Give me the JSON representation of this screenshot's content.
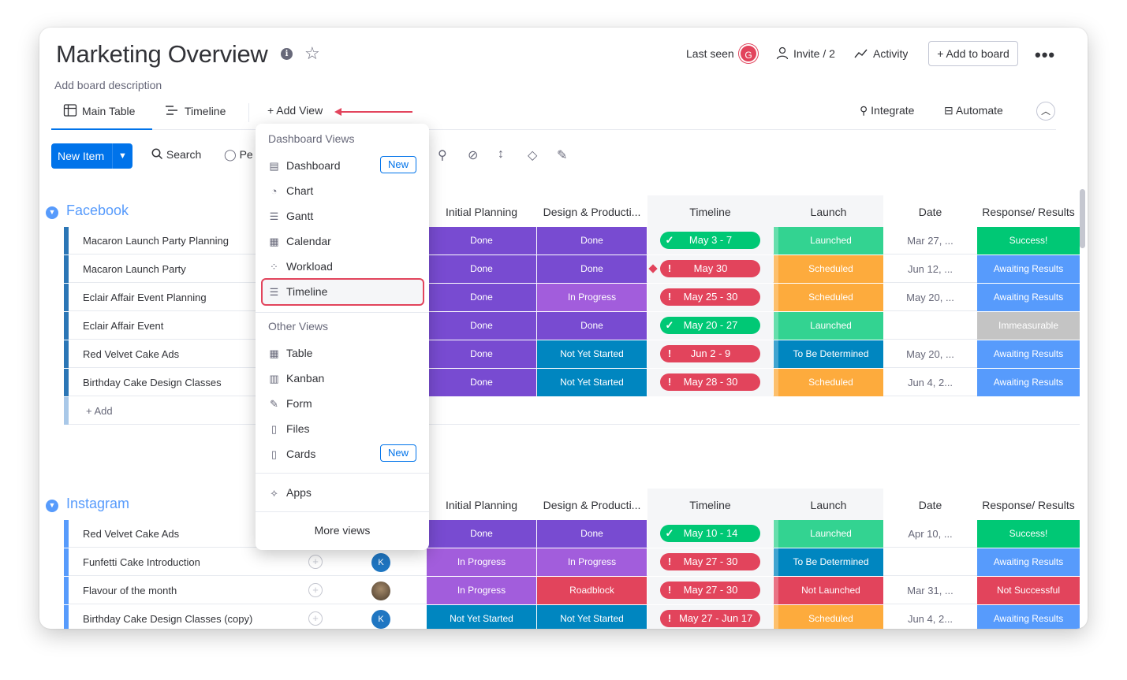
{
  "board": {
    "title": "Marketing Overview",
    "description": "Add board description"
  },
  "header": {
    "last_seen": "Last seen",
    "avatar_letter": "G",
    "invite": "Invite / 2",
    "activity": "Activity",
    "add_to_board": "+ Add to board",
    "more": "•••"
  },
  "tabs": {
    "main_table": "Main Table",
    "timeline": "Timeline",
    "add_view": "+ Add View",
    "integrate": "Integrate",
    "automate": "Automate"
  },
  "toolbar": {
    "new_item": "New Item",
    "search": "Search",
    "person": "Pe"
  },
  "columns": {
    "initial_planning": "Initial Planning",
    "design": "Design & Producti...",
    "timeline": "Timeline",
    "launch": "Launch",
    "date": "Date",
    "response": "Response/ Results"
  },
  "groups": [
    {
      "name": "Facebook",
      "color": "#579bfc",
      "rows": [
        {
          "name": "Macaron Launch Party Planning",
          "planning": "Done",
          "design": "Done",
          "timeline": "May 3 - 7",
          "tl_status": "done",
          "launch": "Launched",
          "date": "Mar 27, ...",
          "result": "Success!"
        },
        {
          "name": "Macaron Launch Party",
          "planning": "Done",
          "design": "Done",
          "timeline": "May 30",
          "tl_status": "alert",
          "launch": "Scheduled",
          "date": "Jun 12, ...",
          "result": "Awaiting Results"
        },
        {
          "name": "Eclair Affair Event Planning",
          "planning": "Done",
          "design": "In Progress",
          "timeline": "May 25 - 30",
          "tl_status": "alert",
          "launch": "Scheduled",
          "date": "May 20, ...",
          "result": "Awaiting Results"
        },
        {
          "name": "Eclair Affair Event",
          "planning": "Done",
          "design": "Done",
          "timeline": "May 20 - 27",
          "tl_status": "done",
          "launch": "Launched",
          "date": "",
          "result": "Immeasurable"
        },
        {
          "name": "Red Velvet Cake Ads",
          "planning": "Done",
          "design": "Not Yet Started",
          "timeline": "Jun 2 - 9",
          "tl_status": "alert",
          "launch": "To Be Determined",
          "date": "May 20, ...",
          "result": "Awaiting Results"
        },
        {
          "name": "Birthday Cake Design Classes",
          "planning": "Done",
          "design": "Not Yet Started",
          "timeline": "May 28 - 30",
          "tl_status": "alert",
          "launch": "Scheduled",
          "date": "Jun 4, 2...",
          "result": "Awaiting Results"
        }
      ],
      "add": "+ Add"
    },
    {
      "name": "Instagram",
      "color": "#579bfc",
      "rows": [
        {
          "name": "Red Velvet Cake Ads",
          "planning": "Done",
          "design": "Done",
          "timeline": "May 10 - 14",
          "tl_status": "done",
          "launch": "Launched",
          "date": "Apr 10, ...",
          "result": "Success!"
        },
        {
          "name": "Funfetti Cake Introduction",
          "planning": "In Progress",
          "design": "In Progress",
          "timeline": "May 27 - 30",
          "tl_status": "alert",
          "launch": "To Be Determined",
          "date": "",
          "result": "Awaiting Results",
          "avatar": "K"
        },
        {
          "name": "Flavour of the month",
          "planning": "In Progress",
          "design": "Roadblock",
          "timeline": "May 27 - 30",
          "tl_status": "alert",
          "launch": "Not Launched",
          "date": "Mar 31, ...",
          "result": "Not Successful",
          "avatar": "photo"
        },
        {
          "name": "Birthday Cake Design Classes (copy)",
          "planning": "Not Yet Started",
          "design": "Not Yet Started",
          "timeline": "May 27 - Jun 17",
          "tl_status": "alert",
          "launch": "Scheduled",
          "date": "Jun 4, 2...",
          "result": "Awaiting Results",
          "avatar": "K"
        }
      ]
    }
  ],
  "status_colors": {
    "Done": "#784bd1",
    "In Progress": "#a25ddc",
    "Not Yet Started": "#0086c0",
    "Roadblock": "#e2445c",
    "Launched": "#33d391",
    "Scheduled": "#fdab3d",
    "To Be Determined": "#0086c0",
    "Not Launched": "#e2445c",
    "Success!": "#00c875",
    "Awaiting Results": "#579bfc",
    "Immeasurable": "#c4c4c4",
    "Not Successful": "#e2445c"
  },
  "menu": {
    "dashboard_header": "Dashboard Views",
    "dashboard_items": [
      {
        "label": "Dashboard",
        "icon": "dashboard-icon",
        "badge": "New"
      },
      {
        "label": "Chart",
        "icon": "chart-icon"
      },
      {
        "label": "Gantt",
        "icon": "gantt-icon"
      },
      {
        "label": "Calendar",
        "icon": "calendar-icon"
      },
      {
        "label": "Workload",
        "icon": "workload-icon"
      },
      {
        "label": "Timeline",
        "icon": "timeline-icon"
      }
    ],
    "other_header": "Other Views",
    "other_items": [
      {
        "label": "Table",
        "icon": "table-icon"
      },
      {
        "label": "Kanban",
        "icon": "kanban-icon"
      },
      {
        "label": "Form",
        "icon": "form-icon"
      },
      {
        "label": "Files",
        "icon": "files-icon"
      },
      {
        "label": "Cards",
        "icon": "cards-icon",
        "badge": "New"
      }
    ],
    "apps": "Apps",
    "more": "More views"
  }
}
